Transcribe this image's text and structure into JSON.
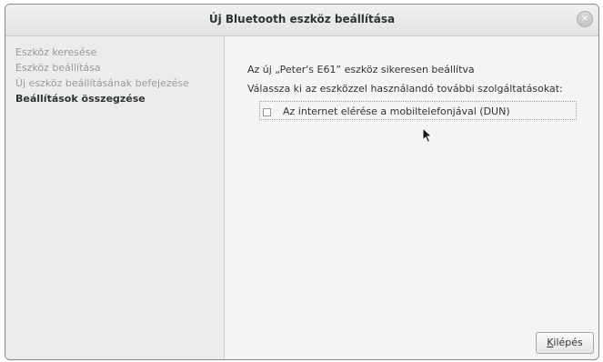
{
  "window": {
    "title": "Új Bluetooth eszköz beállítása",
    "close_glyph": "×"
  },
  "sidebar": {
    "steps": [
      {
        "label": "Eszköz keresése",
        "active": false
      },
      {
        "label": "Eszköz beállítása",
        "active": false
      },
      {
        "label": "Új eszköz beállításának befejezése",
        "active": false
      },
      {
        "label": "Beállítások összegzése",
        "active": true
      }
    ]
  },
  "main": {
    "success_text": "Az új „Peter's E61” eszköz sikeresen beállítva",
    "instruction_text": "Válassza ki az eszközzel használandó további szolgáltatásokat:",
    "services": [
      {
        "label": "Az internet elérése a mobiltelefonjával (DUN)",
        "checked": false
      }
    ]
  },
  "footer": {
    "quit_label": "Kilépés",
    "quit_mnemonic": "K",
    "quit_rest": "ilépés"
  }
}
